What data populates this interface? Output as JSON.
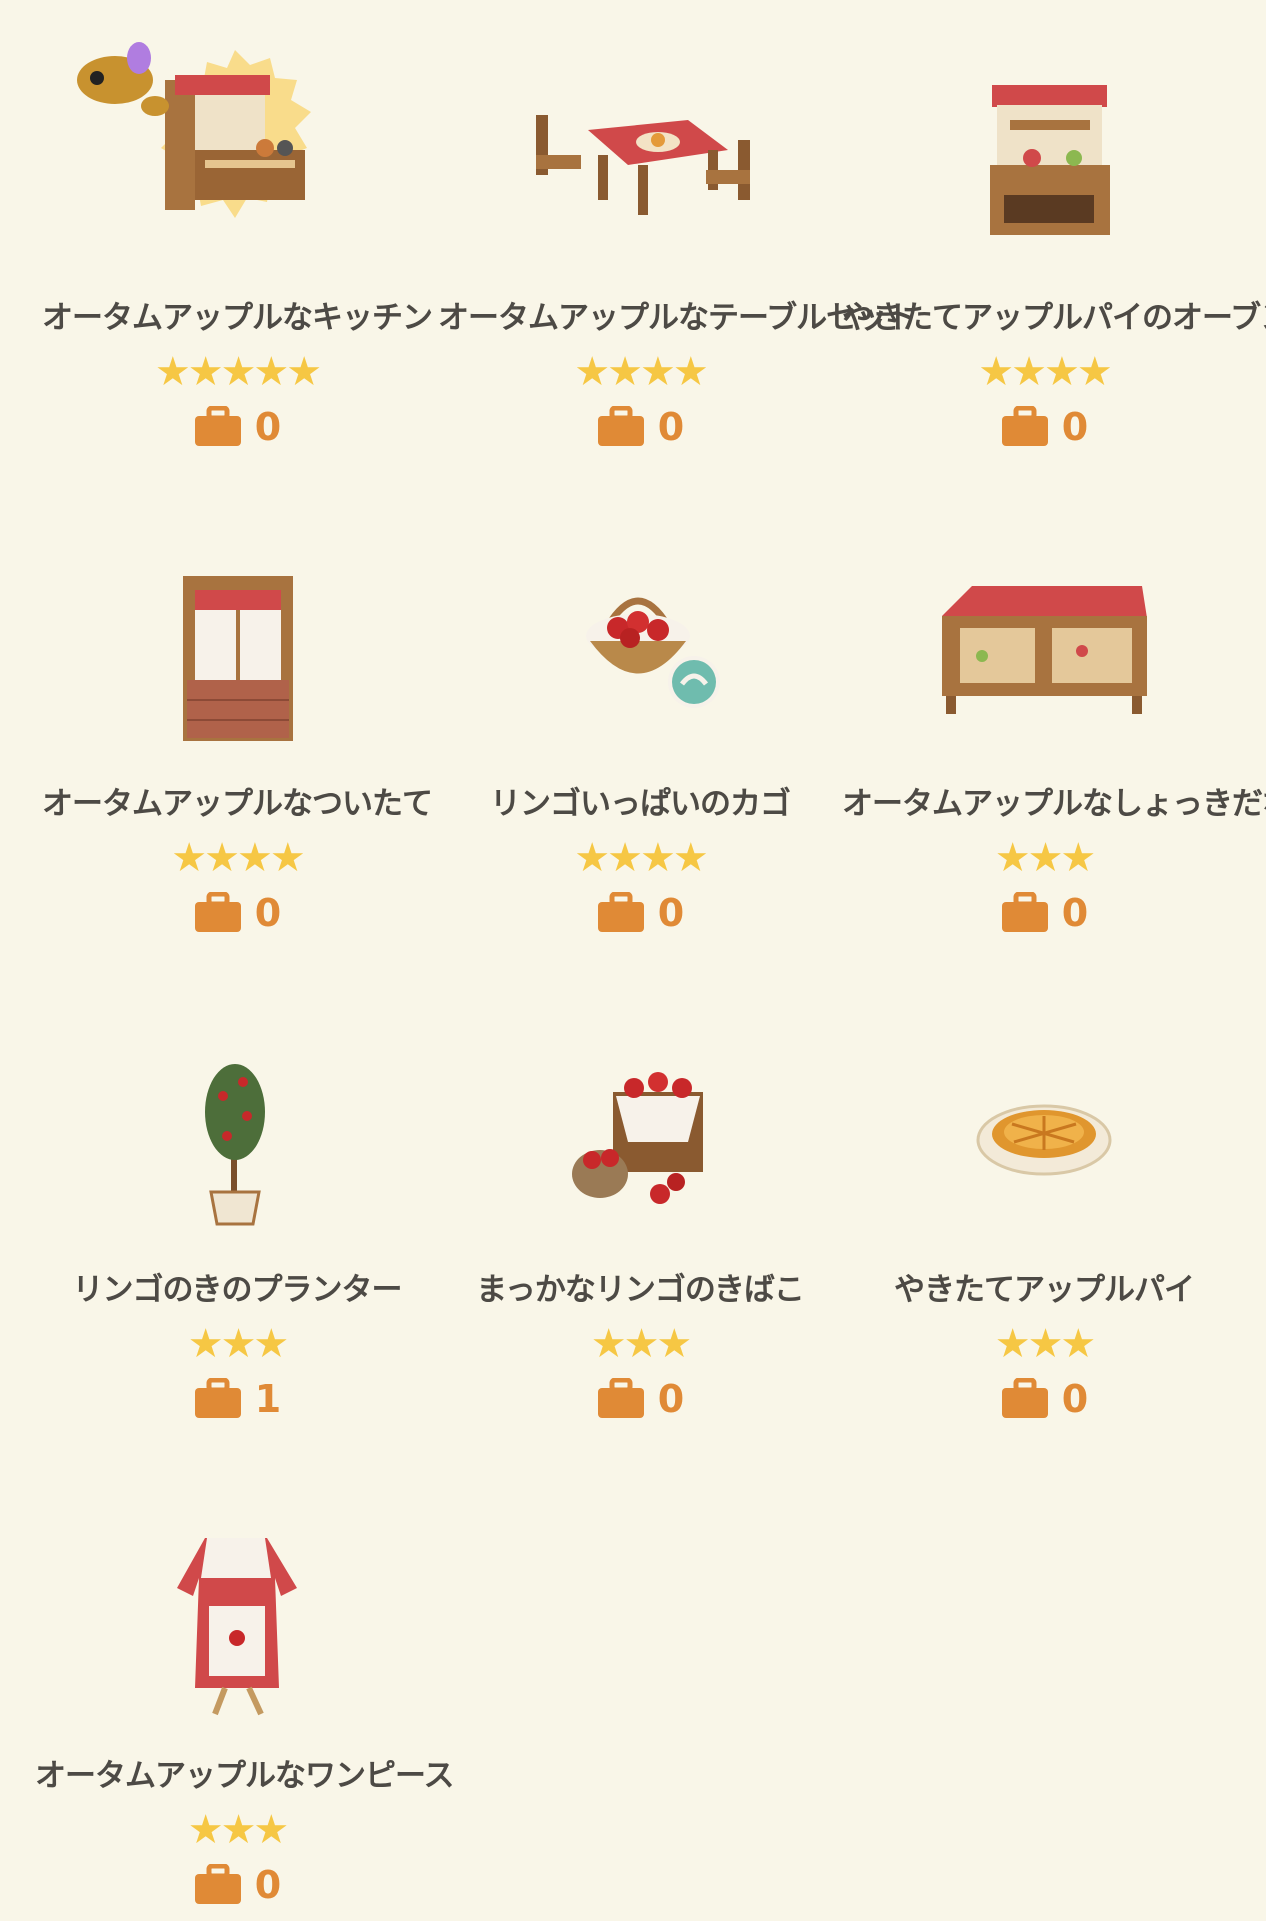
{
  "colors": {
    "background": "#f9f6e8",
    "text": "#4d4a45",
    "star": "#f6c744",
    "bag": "#e08a36",
    "gingham": "#c0393b",
    "wood": "#a8733f"
  },
  "items": [
    {
      "name": "オータムアップルなキッチン",
      "stars": "★★★★★",
      "owned": "0",
      "icon": "kitchen-icon"
    },
    {
      "name": "オータムアップルなテーブルセット",
      "stars": "★★★★",
      "owned": "0",
      "icon": "table-set-icon"
    },
    {
      "name": "やきたてアップルパイのオーブン",
      "stars": "★★★★",
      "owned": "0",
      "icon": "oven-icon"
    },
    {
      "name": "オータムアップルなついたて",
      "stars": "★★★★",
      "owned": "0",
      "icon": "partition-icon"
    },
    {
      "name": "リンゴいっぱいのカゴ",
      "stars": "★★★★",
      "owned": "0",
      "icon": "apple-basket-icon"
    },
    {
      "name": "オータムアップルなしょっきだな",
      "stars": "★★★",
      "owned": "0",
      "icon": "cupboard-icon"
    },
    {
      "name": "リンゴのきのプランター",
      "stars": "★★★",
      "owned": "1",
      "icon": "apple-tree-planter-icon"
    },
    {
      "name": "まっかなリンゴのきばこ",
      "stars": "★★★",
      "owned": "0",
      "icon": "apple-crate-icon"
    },
    {
      "name": "やきたてアップルパイ",
      "stars": "★★★",
      "owned": "0",
      "icon": "apple-pie-icon"
    },
    {
      "name": "オータムアップルなワンピース",
      "stars": "★★★",
      "owned": "0",
      "icon": "dress-icon"
    }
  ]
}
